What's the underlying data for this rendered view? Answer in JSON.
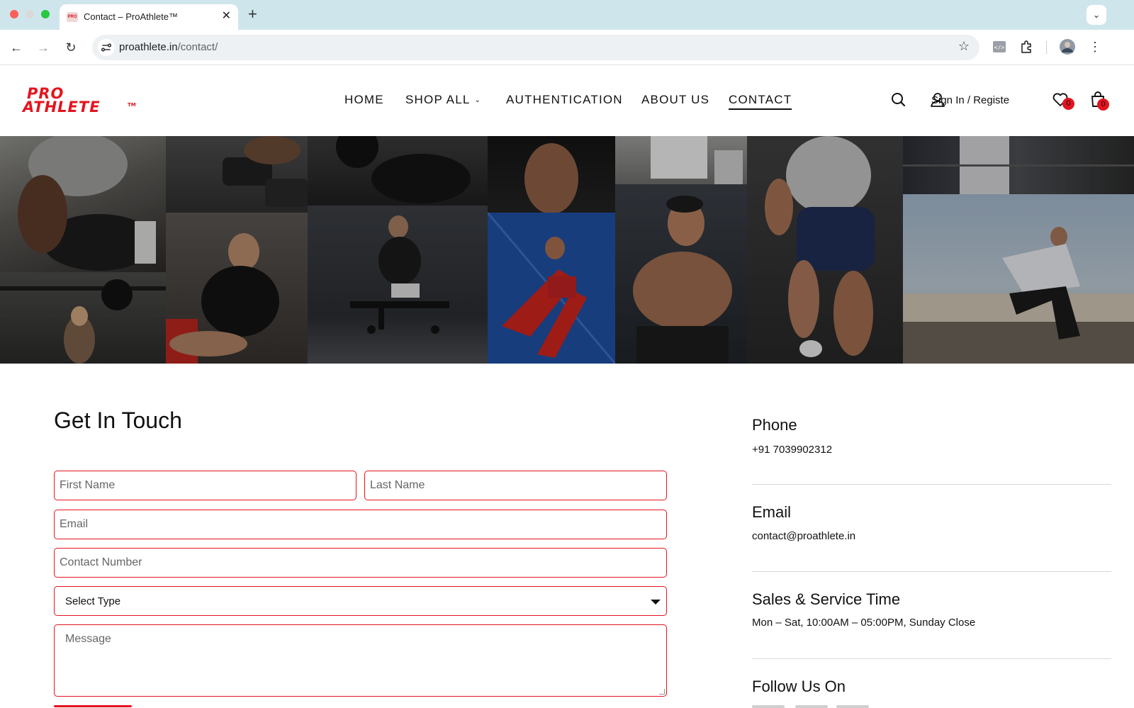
{
  "browser": {
    "tab_title": "Contact – ProAthlete™",
    "favicon_text": "PRO",
    "url_host": "proathlete.in",
    "url_path": "/contact/"
  },
  "site": {
    "logo_line1": "PRO",
    "logo_line2": "ATHLETE",
    "logo_tm": "TM",
    "nav": [
      {
        "label": "HOME"
      },
      {
        "label": "SHOP ALL"
      },
      {
        "label": "AUTHENTICATION"
      },
      {
        "label": "ABOUT US"
      },
      {
        "label": "CONTACT",
        "active": true
      }
    ],
    "signin_label": "Sign In / Registe",
    "wishlist_count": "0",
    "cart_count": "0",
    "accent_color": "#e3141e"
  },
  "form": {
    "title": "Get In Touch",
    "first_name_placeholder": "First Name",
    "last_name_placeholder": "Last Name",
    "email_placeholder": "Email",
    "contact_placeholder": "Contact Number",
    "select_value": "Select Type",
    "message_placeholder": "Message"
  },
  "info": {
    "phone_heading": "Phone",
    "phone_value": "+91 7039902312",
    "email_heading": "Email",
    "email_value": "contact@proathlete.in",
    "hours_heading": "Sales & Service Time",
    "hours_value": "Mon – Sat, 10:00AM – 05:00PM, Sunday Close",
    "follow_heading": "Follow Us On"
  }
}
